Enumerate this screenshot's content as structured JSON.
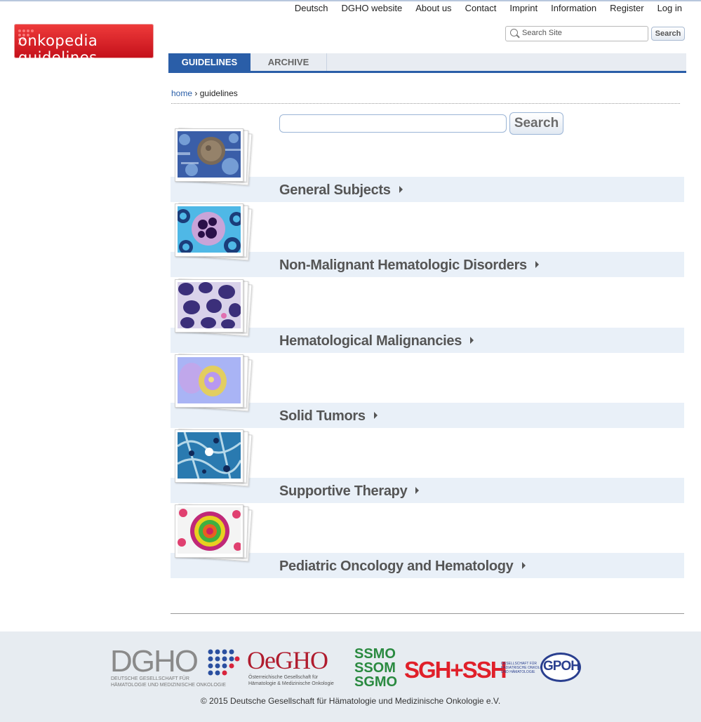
{
  "topnav": [
    "Deutsch",
    "DGHO website",
    "About us",
    "Contact",
    "Imprint",
    "Information",
    "Register",
    "Log in"
  ],
  "logo": {
    "text": "onkopedia guidelines",
    "color": "#d51a24"
  },
  "site_search": {
    "placeholder": "Search Site",
    "button": "Search"
  },
  "tabs": {
    "active": "GUIDELINES",
    "inactive": "ARCHIVE"
  },
  "breadcrumb": {
    "home": "home",
    "separator": "›",
    "current": "guidelines"
  },
  "main_search": {
    "value": "",
    "button": "Search"
  },
  "categories": [
    {
      "label": "General Subjects",
      "icon": "cell-blue-icon"
    },
    {
      "label": "Non-Malignant Hematologic Disorders",
      "icon": "cell-purple-icon"
    },
    {
      "label": "Hematological Malignancies",
      "icon": "cells-violet-icon"
    },
    {
      "label": "Solid Tumors",
      "icon": "fluorescent-cell-icon"
    },
    {
      "label": "Supportive Therapy",
      "icon": "tissue-blue-icon"
    },
    {
      "label": "Pediatric Oncology and Hematology",
      "icon": "rainbow-cell-icon"
    }
  ],
  "footer": {
    "dgho_main": "DGHO",
    "dgho_sub1": "DEUTSCHE GESELLSCHAFT FÜR",
    "dgho_sub2": "HÄMATOLOGIE UND MEDIZINISCHE ONKOLOGIE",
    "oegho_main": "OeGHO",
    "oegho_sub1": "Österreichische Gesellschaft für",
    "oegho_sub2": "Hämatologie & Medizinische Onkologie",
    "ssmo": [
      "SSMO",
      "SSOM",
      "SGMO"
    ],
    "sghssh": "SGH+SSH",
    "gpoh_text1": "GESELLSCHAFT FÜR",
    "gpoh_text2": "PÄDIATRISCHE ONKOLOGIE",
    "gpoh_text3": "UND HÄMATOLOGIE",
    "gpoh": "GPOH",
    "copyright": "© 2015 Deutsche Gesellschaft für Hämatologie und Medizinische Onkologie e.V."
  }
}
